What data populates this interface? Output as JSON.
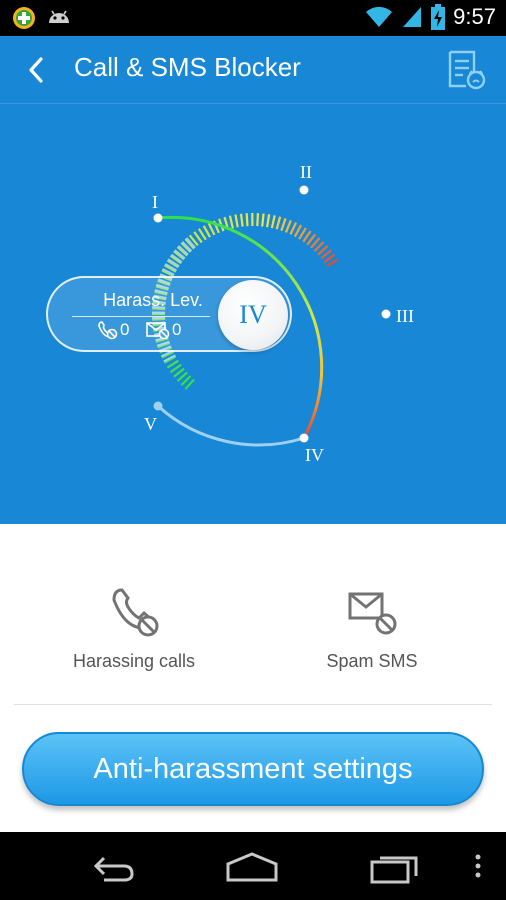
{
  "status_bar": {
    "time": "9:57",
    "icons": [
      "plus-badge-icon",
      "android-icon",
      "wifi-icon",
      "signal-icon",
      "battery-charging-icon"
    ]
  },
  "header": {
    "title": "Call & SMS Blocker",
    "back_icon": "chevron-left-icon",
    "action_icon": "report-list-icon"
  },
  "gauge": {
    "levels": [
      "I",
      "II",
      "III",
      "IV",
      "V"
    ],
    "current_level": "IV",
    "colors": {
      "green": "#2ee04a",
      "yellow": "#f2e64a",
      "red": "#e8482c",
      "dim": "#9fd0f2"
    }
  },
  "level_panel": {
    "label": "Harass. Lev.",
    "call_count": "0",
    "sms_count": "0"
  },
  "tiles": {
    "calls_label": "Harassing calls",
    "sms_label": "Spam SMS"
  },
  "cta": {
    "label": "Anti-harassment settings"
  },
  "colors": {
    "primary": "#1787d6",
    "button_top": "#5bc3f7",
    "button_bottom": "#1d98e6"
  }
}
